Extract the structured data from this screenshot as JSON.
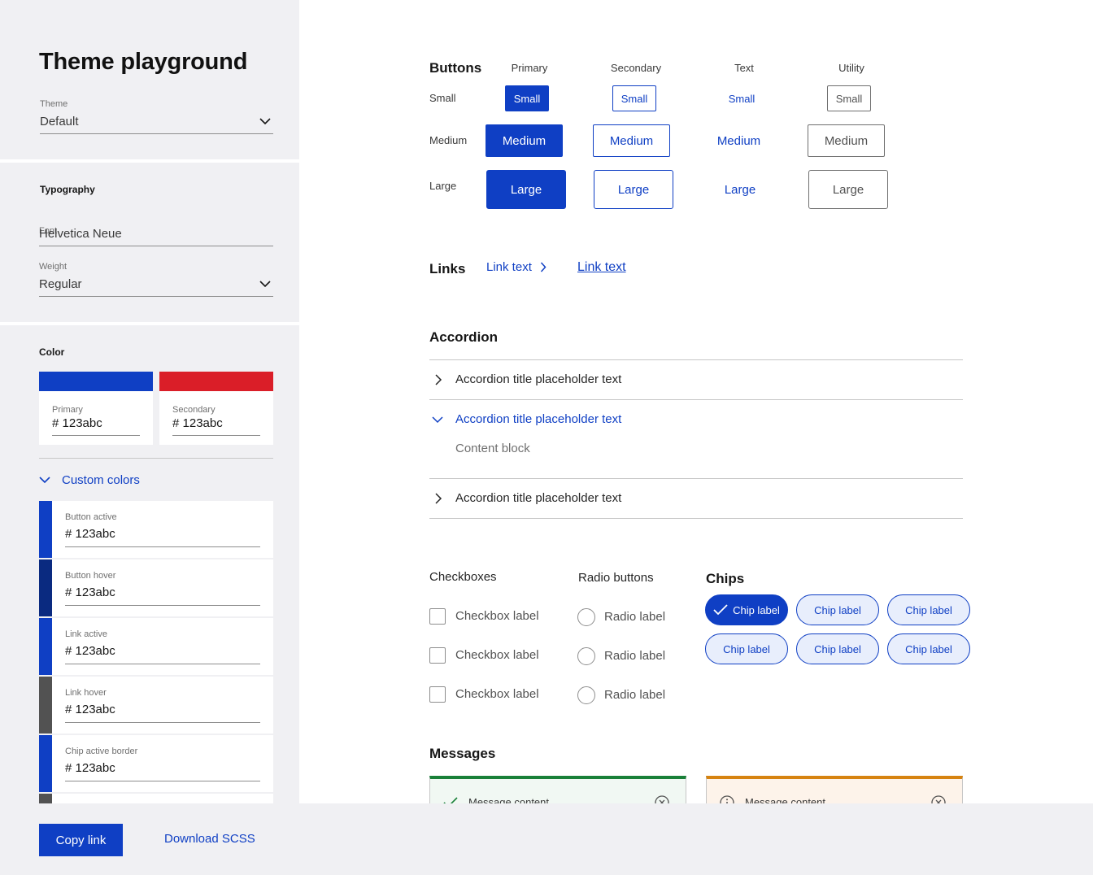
{
  "sidebar": {
    "title": "Theme playground",
    "theme": {
      "label": "Theme",
      "value": "Default"
    },
    "typography": {
      "title": "Typography",
      "font_label": "Font",
      "font_value": "Helvetica Neue",
      "weight_label": "Weight",
      "weight_value": "Regular"
    },
    "color": {
      "title": "Color",
      "primary": {
        "label": "Primary",
        "value": "# 123abc",
        "swatch": "#0f3fc4"
      },
      "secondary": {
        "label": "Secondary",
        "value": "# 123abc",
        "swatch": "#da1e28"
      },
      "custom_toggle": "Custom colors",
      "custom": [
        {
          "label": "Button active",
          "value": "# 123abc",
          "swatch": "#0f3fc4"
        },
        {
          "label": "Button hover",
          "value": "# 123abc",
          "swatch": "#0a2a80"
        },
        {
          "label": "Link active",
          "value": "# 123abc",
          "swatch": "#0f3fc4"
        },
        {
          "label": "Link hover",
          "value": "# 123abc",
          "swatch": "#525252"
        },
        {
          "label": "Chip active border",
          "value": "# 123abc",
          "swatch": "#0f3fc4"
        },
        {
          "label": "",
          "value": "",
          "swatch": "#525252"
        }
      ]
    }
  },
  "footer": {
    "copy_label": "Copy link",
    "download_label": "Download SCSS"
  },
  "main": {
    "buttons": {
      "title": "Buttons",
      "columns": [
        "Primary",
        "Secondary",
        "Text",
        "Utility"
      ],
      "rows": [
        "Small",
        "Medium",
        "Large"
      ],
      "small": "Small",
      "medium": "Medium",
      "large": "Large"
    },
    "links": {
      "title": "Links",
      "link1": "Link text",
      "link2": "Link text"
    },
    "accordion": {
      "title": "Accordion",
      "items": [
        {
          "title": "Accordion title placeholder text",
          "open": false
        },
        {
          "title": "Accordion title placeholder text",
          "open": true,
          "content": "Content block"
        },
        {
          "title": "Accordion title placeholder text",
          "open": false
        }
      ]
    },
    "checkboxes": {
      "title": "Checkboxes",
      "items": [
        "Checkbox label",
        "Checkbox label",
        "Checkbox label"
      ]
    },
    "radios": {
      "title": "Radio buttons",
      "items": [
        "Radio label",
        "Radio label",
        "Radio label"
      ]
    },
    "chips": {
      "title": "Chips",
      "items": [
        "Chip label",
        "Chip label",
        "Chip label",
        "Chip label",
        "Chip label",
        "Chip label"
      ],
      "active_index": 0
    },
    "messages": {
      "title": "Messages",
      "items": [
        {
          "text": "Message content",
          "kind": "success",
          "accent": "#198038"
        },
        {
          "text": "Message content",
          "kind": "warning",
          "accent": "#d68310"
        }
      ]
    }
  },
  "colors": {
    "accent": "#0f3fc4",
    "secondary": "#da1e28",
    "sidebar_bg": "#f0f0f3"
  },
  "icons": [
    "chevron-down-icon",
    "chevron-right-icon",
    "checkmark-icon",
    "info-icon",
    "close-circle-icon"
  ]
}
